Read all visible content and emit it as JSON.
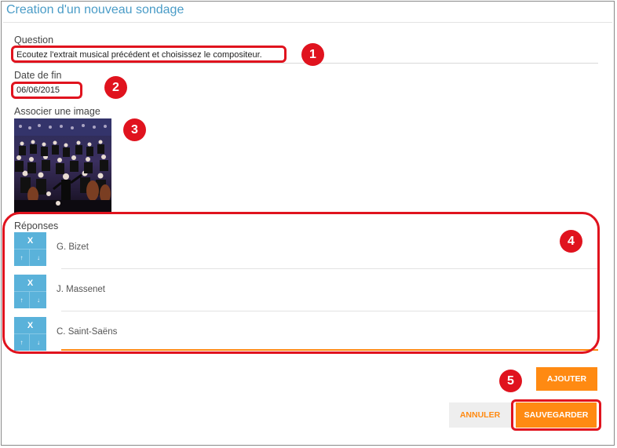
{
  "window": {
    "title": "Creation d'un nouveau sondage"
  },
  "form": {
    "question_label": "Question",
    "question_value": "Ecoutez l'extrait musical précédent et choisissez le compositeur.",
    "date_label": "Date de fin",
    "date_value": "06/06/2015",
    "image_label": "Associer une image",
    "answers_label": "Réponses",
    "answers": [
      {
        "text": "G. Bizet"
      },
      {
        "text": "J. Massenet"
      },
      {
        "text": "C. Saint-Saëns"
      }
    ],
    "answer_controls": {
      "remove": "X",
      "up": "↑",
      "down": "↓"
    }
  },
  "buttons": {
    "add": "AJOUTER",
    "cancel": "ANNULER",
    "save": "SAUVEGARDER"
  },
  "annotations": [
    "1",
    "2",
    "3",
    "4",
    "5"
  ],
  "colors": {
    "title": "#4a9cc7",
    "annotation": "#e0131e",
    "accent": "#ff8a12",
    "control": "#5ab2da"
  }
}
